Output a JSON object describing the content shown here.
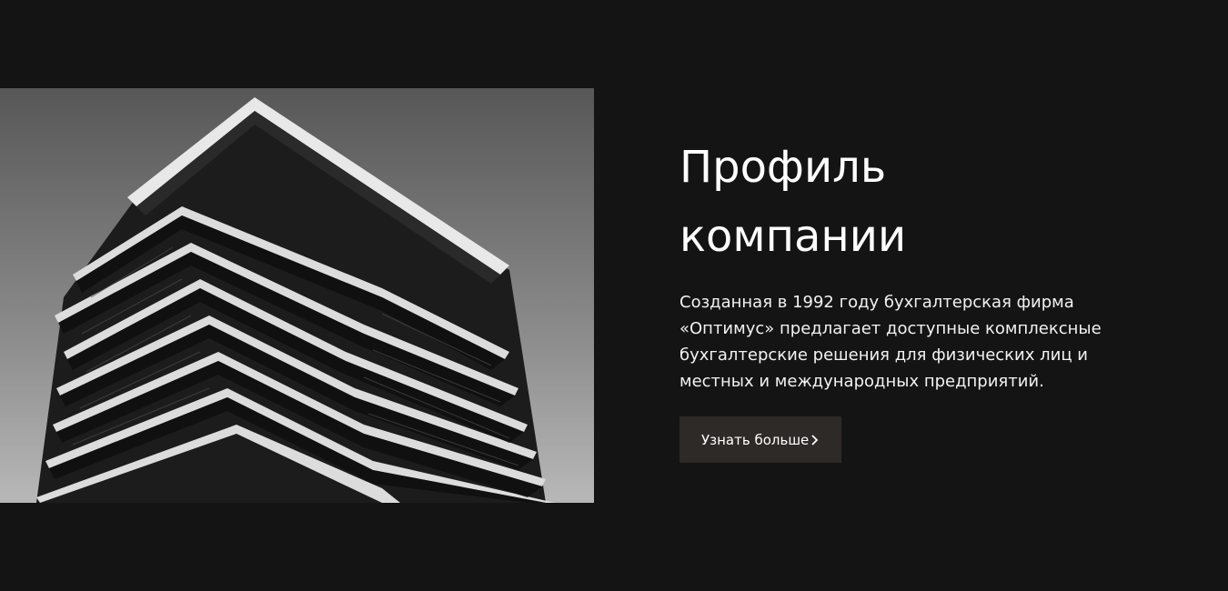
{
  "hero": {
    "title": "Профиль компании",
    "description": "Созданная в 1992 году бухгалтерская фирма «Оптимус» предлагает доступные комплексные бухгалтерские решения для физических лиц и местных и международных предприятий.",
    "cta_label": "Узнать больше",
    "cta_icon": "chevron-right-icon"
  },
  "colors": {
    "background": "#141414",
    "button": "#2e2a28",
    "text": "#ffffff"
  }
}
